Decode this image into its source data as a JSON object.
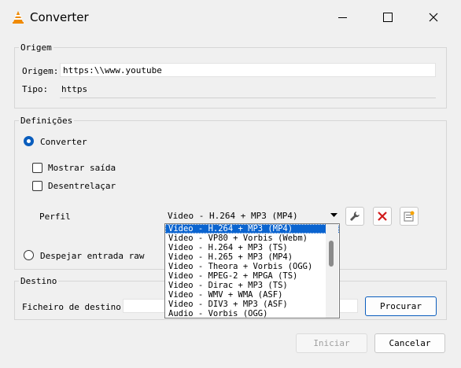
{
  "window": {
    "title": "Converter"
  },
  "origem": {
    "group_label": "Origem",
    "origem_label": "Origem:",
    "origem_value": "https:\\\\www.youtube",
    "tipo_label": "Tipo:",
    "tipo_value": "https"
  },
  "definicoes": {
    "group_label": "Definições",
    "converter_label": "Converter",
    "mostrar_label": "Mostrar saída",
    "desentrelacar_label": "Desentrelaçar",
    "perfil_label": "Perfil",
    "perfil_selected": "Video - H.264 + MP3 (MP4)",
    "despejar_label": "Despejar entrada raw",
    "profiles": [
      "Video - H.264 + MP3 (MP4)",
      "Video - VP80 + Vorbis (Webm)",
      "Video - H.264 + MP3 (TS)",
      "Video - H.265 + MP3 (MP4)",
      "Video - Theora + Vorbis (OGG)",
      "Video - MPEG-2 + MPGA (TS)",
      "Video - Dirac + MP3 (TS)",
      "Video - WMV + WMA (ASF)",
      "Video - DIV3 + MP3 (ASF)",
      "Audio - Vorbis (OGG)"
    ]
  },
  "destino": {
    "group_label": "Destino",
    "ficheiro_label": "Ficheiro de destino:",
    "procurar_label": "Procurar"
  },
  "footer": {
    "iniciar_label": "Iniciar",
    "cancelar_label": "Cancelar"
  },
  "colors": {
    "accent": "#0a5dbd",
    "delete_red": "#d11a1a"
  }
}
